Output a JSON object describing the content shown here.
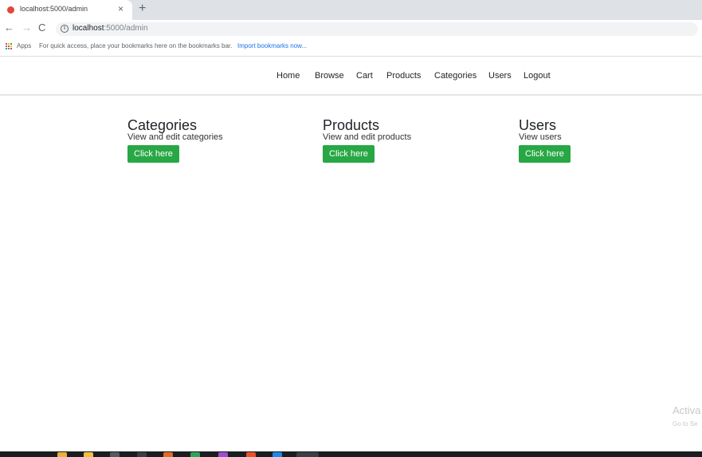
{
  "browser": {
    "tab": {
      "title": "localhost:5000/admin",
      "close_glyph": "×"
    },
    "new_tab_glyph": "+",
    "nav": {
      "back": "←",
      "forward": "→",
      "reload": "C"
    },
    "omnibox": {
      "info_glyph": "i",
      "host": "localhost",
      "path": ":5000/admin"
    },
    "bookmarks": {
      "apps_label": "Apps",
      "hint": "For quick access, place your bookmarks here on the bookmarks bar.",
      "import_link": "Import bookmarks now..."
    }
  },
  "site_nav": {
    "links": [
      "Home",
      "Browse",
      "Cart",
      "Products",
      "Categories",
      "Users",
      "Logout"
    ]
  },
  "cards": [
    {
      "title": "Categories",
      "description": "View and edit categories",
      "button": "Click here"
    },
    {
      "title": "Products",
      "description": "View and edit products",
      "button": "Click here"
    },
    {
      "title": "Users",
      "description": "View users",
      "button": "Click here"
    }
  ],
  "watermark": {
    "line1": "Activa",
    "line2": "Go to Se"
  },
  "colors": {
    "button_green": "#28a745",
    "tab_strip": "#dee1e6",
    "favicon_red": "#e2463c",
    "link_blue": "#1a73e8"
  },
  "icons": {
    "favicon": "red-circle-icon",
    "apps": "apps-grid-icon",
    "info": "info-circle-icon"
  }
}
